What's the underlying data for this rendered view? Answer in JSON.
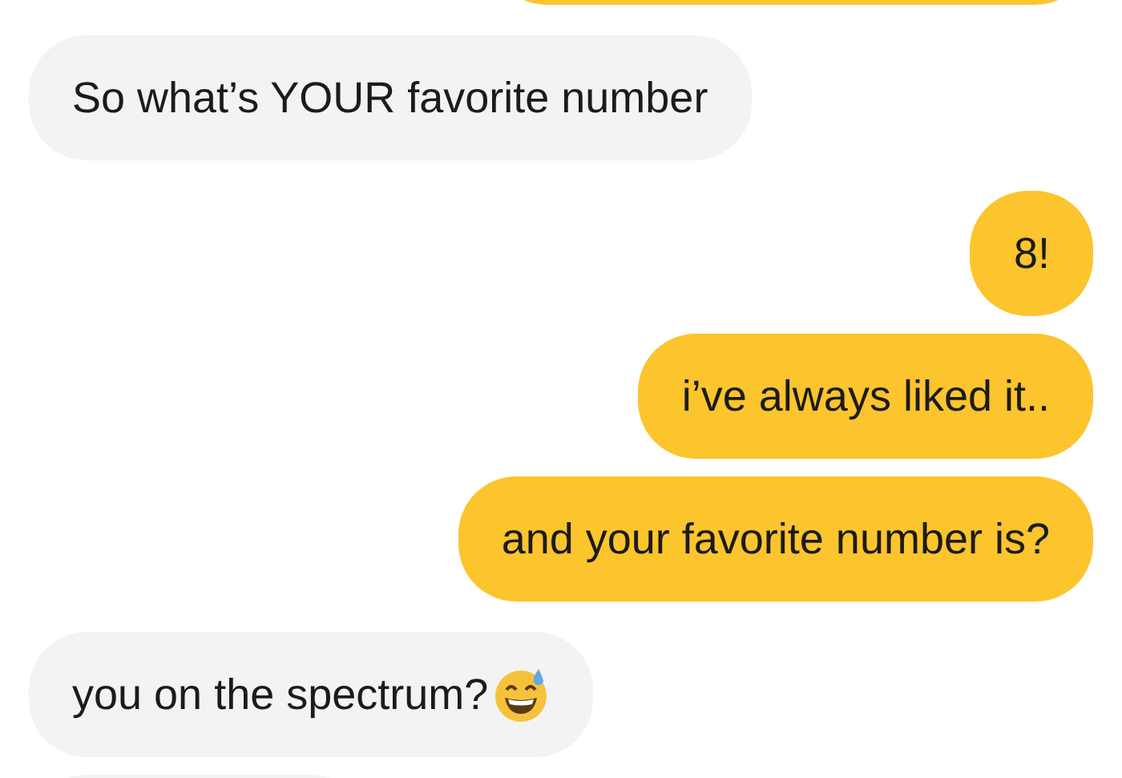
{
  "messages": [
    {
      "kind": "sent"
    },
    {
      "kind": "received",
      "parts": [
        {
          "kind": "text",
          "text": "So what’s YOUR favorite number"
        }
      ]
    },
    {
      "kind": "sent",
      "parts": [
        {
          "kind": "text",
          "text": "8!"
        }
      ]
    },
    {
      "kind": "sent",
      "parts": [
        {
          "kind": "text",
          "text": "i’ve always liked it.."
        }
      ]
    },
    {
      "kind": "sent",
      "parts": [
        {
          "kind": "text",
          "text": "and your favorite number is?"
        }
      ]
    },
    {
      "kind": "received",
      "parts": [
        {
          "kind": "text",
          "text": "you on the spectrum?"
        },
        {
          "kind": "sweat_smile_emoji"
        }
      ]
    },
    {
      "kind": "received"
    }
  ]
}
